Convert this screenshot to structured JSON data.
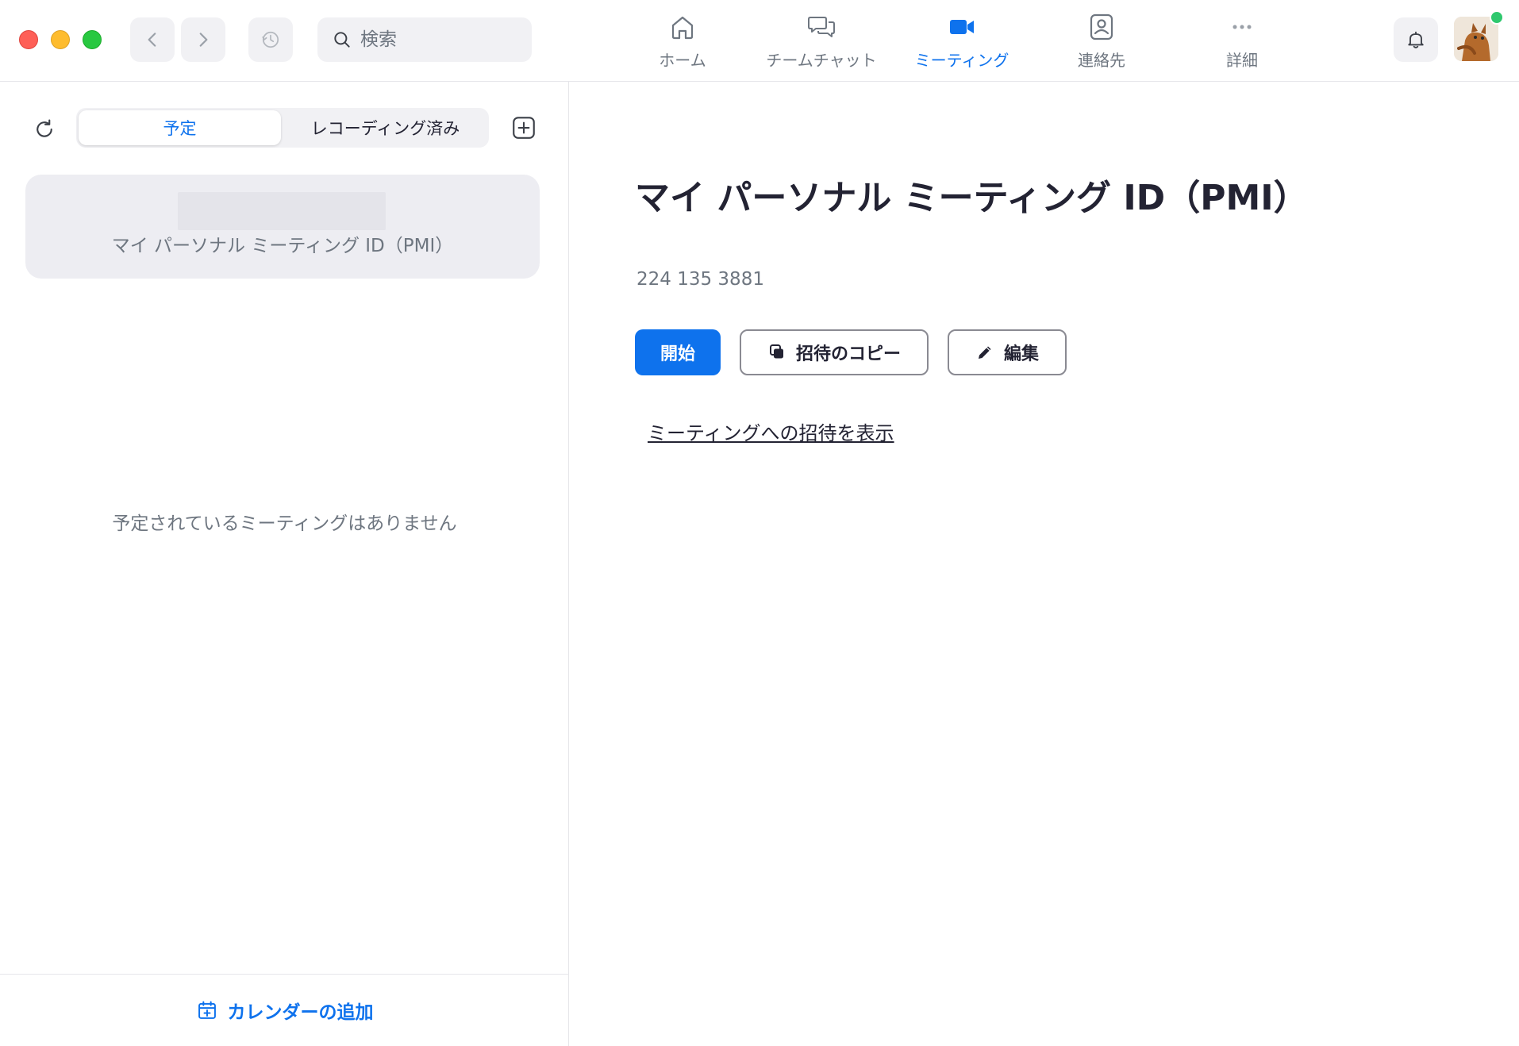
{
  "window": {
    "controls": [
      "close",
      "minimize",
      "zoom"
    ]
  },
  "toolbar": {
    "back_icon": "chevron-left-icon",
    "forward_icon": "chevron-right-icon",
    "history_icon": "history-clock-icon",
    "search_placeholder": "検索"
  },
  "nav": {
    "tabs": [
      {
        "label": "ホーム",
        "icon": "home-icon",
        "active": false
      },
      {
        "label": "チームチャット",
        "icon": "chat-icon",
        "active": false
      },
      {
        "label": "ミーティング",
        "icon": "video-camera-icon",
        "active": true
      },
      {
        "label": "連絡先",
        "icon": "contact-icon",
        "active": false
      },
      {
        "label": "詳細",
        "icon": "more-dots-icon",
        "active": false
      }
    ],
    "accent_color": "#0e72ed",
    "inactive_color": "#6e7680"
  },
  "status": {
    "presence_color": "#2fc86e"
  },
  "left_panel": {
    "segments": {
      "scheduled": "予定",
      "recorded": "レコーディング済み"
    },
    "pmi_card_label": "マイ パーソナル ミーティング ID（PMI）",
    "empty_text": "予定されているミーティングはありません",
    "footer_link": "カレンダーの追加"
  },
  "meeting_detail": {
    "title": "マイ パーソナル ミーティング ID（PMI）",
    "meeting_id": "224 135 3881",
    "buttons": {
      "start": "開始",
      "copy_invite": "招待のコピー",
      "edit": "編集"
    },
    "show_invite_link": "ミーティングへの招待を表示"
  }
}
